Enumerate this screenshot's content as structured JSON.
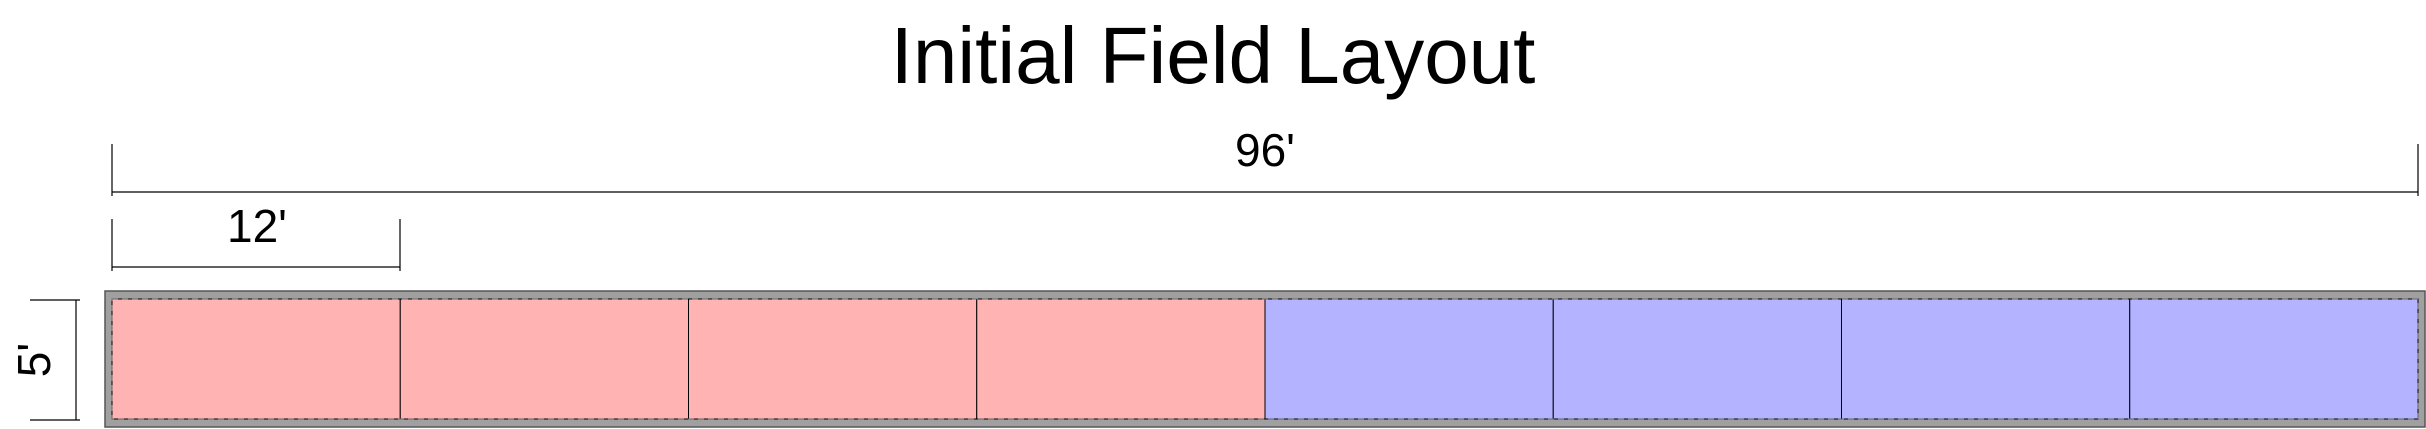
{
  "title": "Initial Field Layout",
  "dimensions": {
    "total_length": "96'",
    "plot_length": "12'",
    "field_width": "5'"
  },
  "field": {
    "plot_count": 8,
    "plot_length_ft": 12,
    "total_length_ft": 96,
    "width_ft": 5,
    "plots": [
      {
        "group": "red"
      },
      {
        "group": "red"
      },
      {
        "group": "red"
      },
      {
        "group": "red"
      },
      {
        "group": "blue"
      },
      {
        "group": "blue"
      },
      {
        "group": "blue"
      },
      {
        "group": "blue"
      }
    ]
  },
  "colors": {
    "red": "#ffb3b3",
    "blue": "#b3b3ff",
    "border": "#a0a0a0",
    "line": "#000000"
  }
}
